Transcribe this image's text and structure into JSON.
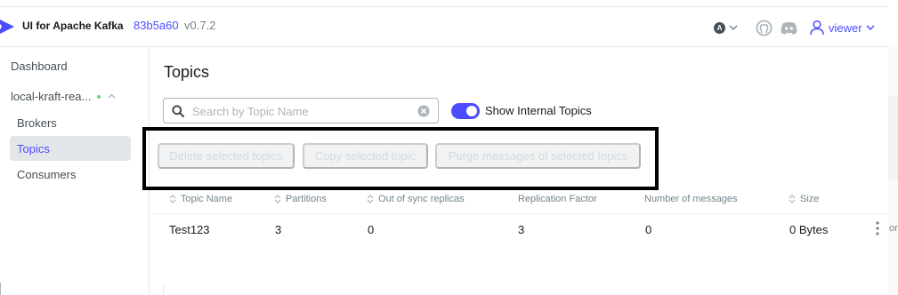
{
  "header": {
    "app_title": "UI for Apache Kafka",
    "version_hash": "83b5a60",
    "version_number": "v0.7.2",
    "language_badge": "A",
    "user_label": "viewer"
  },
  "sidebar": {
    "dashboard": "Dashboard",
    "cluster_name": "local-kraft-rea...",
    "brokers": "Brokers",
    "topics": "Topics",
    "consumers": "Consumers"
  },
  "main": {
    "title": "Topics",
    "search_placeholder": "Search by Topic Name",
    "search_value": "",
    "toggle_label": "Show Internal Topics",
    "toggle_on": true,
    "buttons": {
      "delete": "Delete selected topics",
      "copy": "Copy selected topic",
      "purge": "Purge messages of selected topics"
    }
  },
  "table": {
    "columns": [
      "Topic Name",
      "Partitions",
      "Out of sync replicas",
      "Replication Factor",
      "Number of messages",
      "Size"
    ],
    "rows": [
      [
        "Test123",
        "3",
        "0",
        "3",
        "0",
        "0 Bytes"
      ]
    ],
    "cut_off_text": "or"
  },
  "colors": {
    "accent": "#4c4cff",
    "status_online": "#5cd685",
    "highlight_border": "#000000"
  }
}
